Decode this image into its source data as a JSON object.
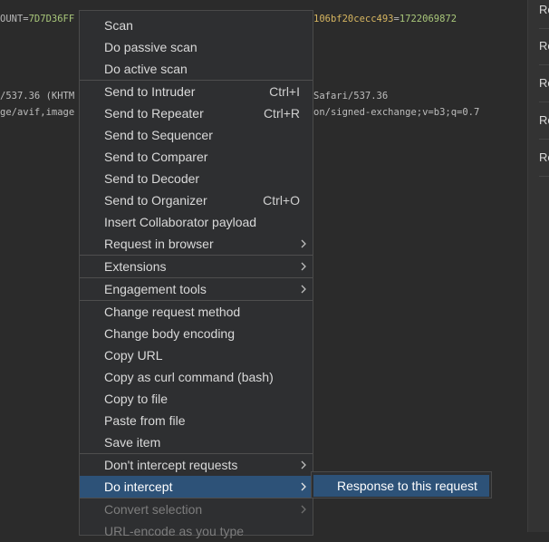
{
  "editor": {
    "line1": {
      "a": "OUNT=",
      "b": "7D7D36FF",
      "c": "106bf20cecc493",
      "d": "=",
      "e": "1722069872"
    },
    "line2": {
      "a": "/537.36 (KHTM",
      "b": "Safari/537.36"
    },
    "line3": {
      "a": "ge/avif,image",
      "b": "on/signed-exchange;v=b3;q=0.7"
    }
  },
  "right_panel": {
    "items": [
      "Re",
      "Re",
      "Re",
      "Re",
      "Re"
    ]
  },
  "context_menu": {
    "items": [
      {
        "label": "Scan"
      },
      {
        "label": "Do passive scan"
      },
      {
        "label": "Do active scan"
      },
      {
        "label": "Send to Intruder",
        "shortcut": "Ctrl+I"
      },
      {
        "label": "Send to Repeater",
        "shortcut": "Ctrl+R"
      },
      {
        "label": "Send to Sequencer"
      },
      {
        "label": "Send to Comparer"
      },
      {
        "label": "Send to Decoder"
      },
      {
        "label": "Send to Organizer",
        "shortcut": "Ctrl+O"
      },
      {
        "label": "Insert Collaborator payload"
      },
      {
        "label": "Request in browser"
      },
      {
        "label": "Extensions"
      },
      {
        "label": "Engagement tools"
      },
      {
        "label": "Change request method"
      },
      {
        "label": "Change body encoding"
      },
      {
        "label": "Copy URL"
      },
      {
        "label": "Copy as curl command (bash)"
      },
      {
        "label": "Copy to file"
      },
      {
        "label": "Paste from file"
      },
      {
        "label": "Save item"
      },
      {
        "label": "Don't intercept requests"
      },
      {
        "label": "Do intercept"
      },
      {
        "label": "Convert selection"
      },
      {
        "label": "URL-encode as you type"
      }
    ]
  },
  "submenu": {
    "items": [
      {
        "label": "Response to this request"
      }
    ]
  },
  "colors": {
    "menu_bg": "#2e2f31",
    "highlight": "#2d5278",
    "editor_bg": "#2b2b2b"
  }
}
